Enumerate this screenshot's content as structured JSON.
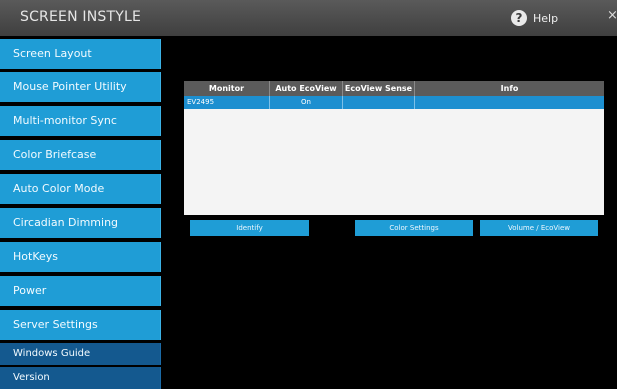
{
  "app": {
    "title": "SCREEN INSTYLE",
    "help_label": "Help",
    "close_glyph": "×"
  },
  "icons": {
    "help": "help-circle-icon",
    "close": "close-icon"
  },
  "colors": {
    "nav": "#1f9dd6",
    "nav_dark": "#14598f",
    "selected_row": "#1d8fd0",
    "titlebar": "#4a4a4a"
  },
  "sidebar": {
    "items": [
      {
        "label": "Screen Layout"
      },
      {
        "label": "Mouse Pointer Utility"
      },
      {
        "label": "Multi-monitor Sync"
      },
      {
        "label": "Color Briefcase"
      },
      {
        "label": "Auto Color Mode"
      },
      {
        "label": "Circadian Dimming"
      },
      {
        "label": "HotKeys"
      },
      {
        "label": "Power"
      },
      {
        "label": "Server Settings"
      },
      {
        "label": "Windows Guide"
      },
      {
        "label": "Version"
      }
    ]
  },
  "table": {
    "columns": [
      "Monitor",
      "Auto EcoView",
      "EcoView Sense",
      "Info"
    ],
    "rows": [
      {
        "monitor": "EV2495",
        "auto_ecoview": "On",
        "ecoview_sense": "",
        "info": ""
      }
    ]
  },
  "buttons": {
    "identify": "Identify",
    "color_settings": "Color Settings",
    "volume_ecoview": "Volume / EcoView"
  }
}
